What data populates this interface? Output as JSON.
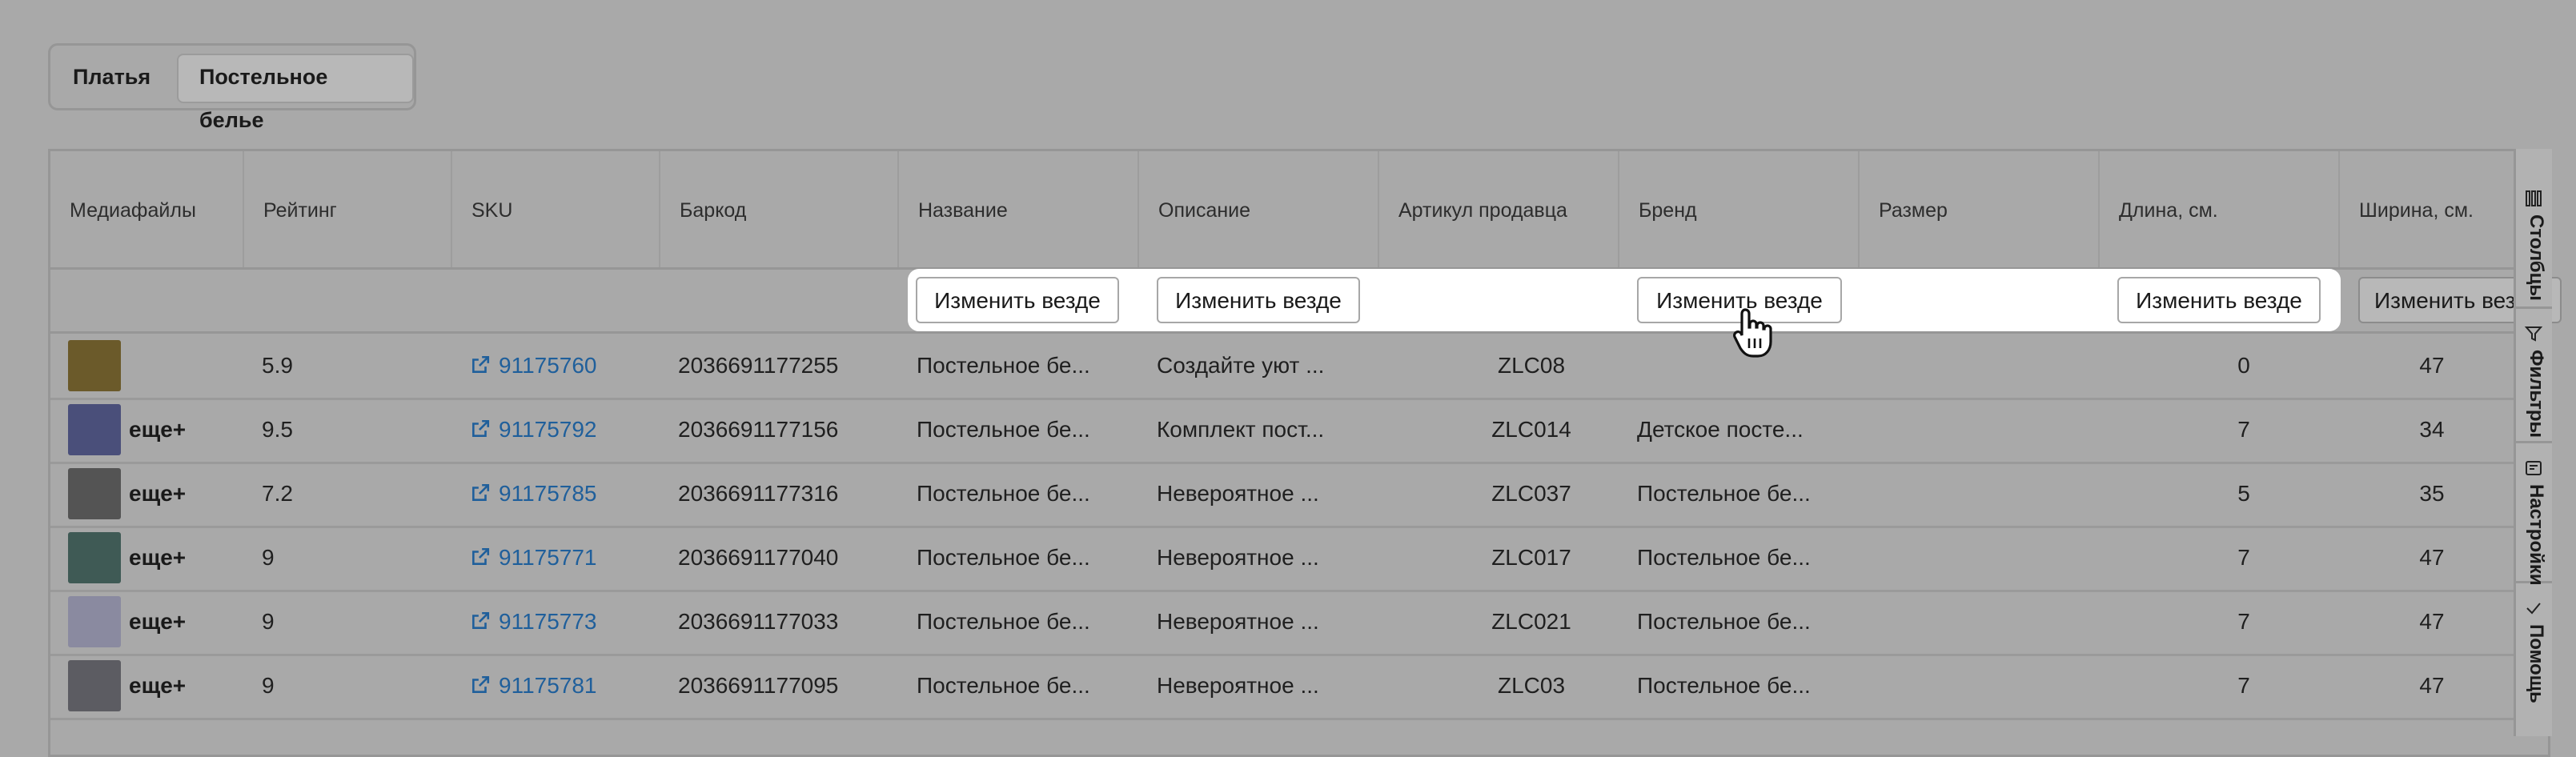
{
  "tabs": [
    {
      "label": "Платья"
    },
    {
      "label": "Постельное белье"
    }
  ],
  "columns": [
    {
      "label": "Медиафайлы"
    },
    {
      "label": "Рейтинг"
    },
    {
      "label": "SKU"
    },
    {
      "label": "Баркод"
    },
    {
      "label": "Название"
    },
    {
      "label": "Описание"
    },
    {
      "label": "Артикул продавца"
    },
    {
      "label": "Бренд"
    },
    {
      "label": "Размер"
    },
    {
      "label": "Длина, см."
    },
    {
      "label": "Ширина, см."
    }
  ],
  "bulk_edit_label": "Изменить везде",
  "more_label": "еще+",
  "rows": [
    {
      "rating": "5.9",
      "sku": "91175760",
      "barcode": "2036691177255",
      "name": "Постельное бе...",
      "description": "Создайте уют ...",
      "vendor_code": "ZLC08",
      "brand": "",
      "size": "",
      "length": "0",
      "width": "47",
      "has_more": false
    },
    {
      "rating": "9.5",
      "sku": "91175792",
      "barcode": "2036691177156",
      "name": "Постельное бе...",
      "description": "Комплект пост...",
      "vendor_code": "ZLC014",
      "brand": "Детское посте...",
      "size": "",
      "length": "7",
      "width": "34",
      "has_more": true
    },
    {
      "rating": "7.2",
      "sku": "91175785",
      "barcode": "2036691177316",
      "name": "Постельное бе...",
      "description": "Невероятное ...",
      "vendor_code": "ZLC037",
      "brand": "Постельное бе...",
      "size": "",
      "length": "5",
      "width": "35",
      "has_more": true
    },
    {
      "rating": "9",
      "sku": "91175771",
      "barcode": "2036691177040",
      "name": "Постельное бе...",
      "description": "Невероятное ...",
      "vendor_code": "ZLC017",
      "brand": "Постельное бе...",
      "size": "",
      "length": "7",
      "width": "47",
      "has_more": true
    },
    {
      "rating": "9",
      "sku": "91175773",
      "barcode": "2036691177033",
      "name": "Постельное бе...",
      "description": "Невероятное ...",
      "vendor_code": "ZLC021",
      "brand": "Постельное бе...",
      "size": "",
      "length": "7",
      "width": "47",
      "has_more": true
    },
    {
      "rating": "9",
      "sku": "91175781",
      "barcode": "2036691177095",
      "name": "Постельное бе...",
      "description": "Невероятное ...",
      "vendor_code": "ZLC03",
      "brand": "Постельное бе...",
      "size": "",
      "length": "7",
      "width": "47",
      "has_more": true
    }
  ],
  "thumb_colors": [
    "#6b5a2a",
    "#4a4f7a",
    "#545454",
    "#3f5a55",
    "#8a8aa0",
    "#5c5c62"
  ],
  "side_panel": [
    {
      "label": "Столбцы",
      "icon": "columns-icon"
    },
    {
      "label": "Фильтры",
      "icon": "filter-icon"
    },
    {
      "label": "Настройки",
      "icon": "settings-icon"
    },
    {
      "label": "Помощь",
      "icon": "help-icon"
    }
  ],
  "colors": {
    "link": "#1f5f9b",
    "overlay": "#a9a9a9",
    "highlight": "#ffffff"
  }
}
